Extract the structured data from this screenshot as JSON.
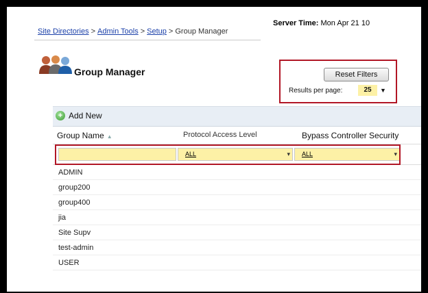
{
  "breadcrumb": {
    "items": [
      "Site Directories",
      "Admin Tools",
      "Setup"
    ],
    "current": "Group Manager",
    "separator": ">"
  },
  "server_time": {
    "label": "Server Time:",
    "value": "Mon Apr 21 10"
  },
  "page": {
    "title": "Group Manager",
    "icon": "users-group-icon"
  },
  "filters": {
    "reset_label": "Reset Filters",
    "results_per_page_label": "Results per page:",
    "results_per_page_value": "25"
  },
  "grid": {
    "add_new_label": "Add New",
    "columns": [
      "Group Name",
      "Protocol Access Level",
      "Bypass Controller Security"
    ],
    "filter_values": [
      "",
      "ALL",
      "ALL"
    ],
    "rows": [
      "ADMIN",
      "group200",
      "group400",
      "jia",
      "Site Supv",
      "test-admin",
      "USER"
    ]
  },
  "colors": {
    "highlight_border": "#b11625",
    "filter_fill": "#fdf1a6",
    "link": "#1a3fa8"
  }
}
